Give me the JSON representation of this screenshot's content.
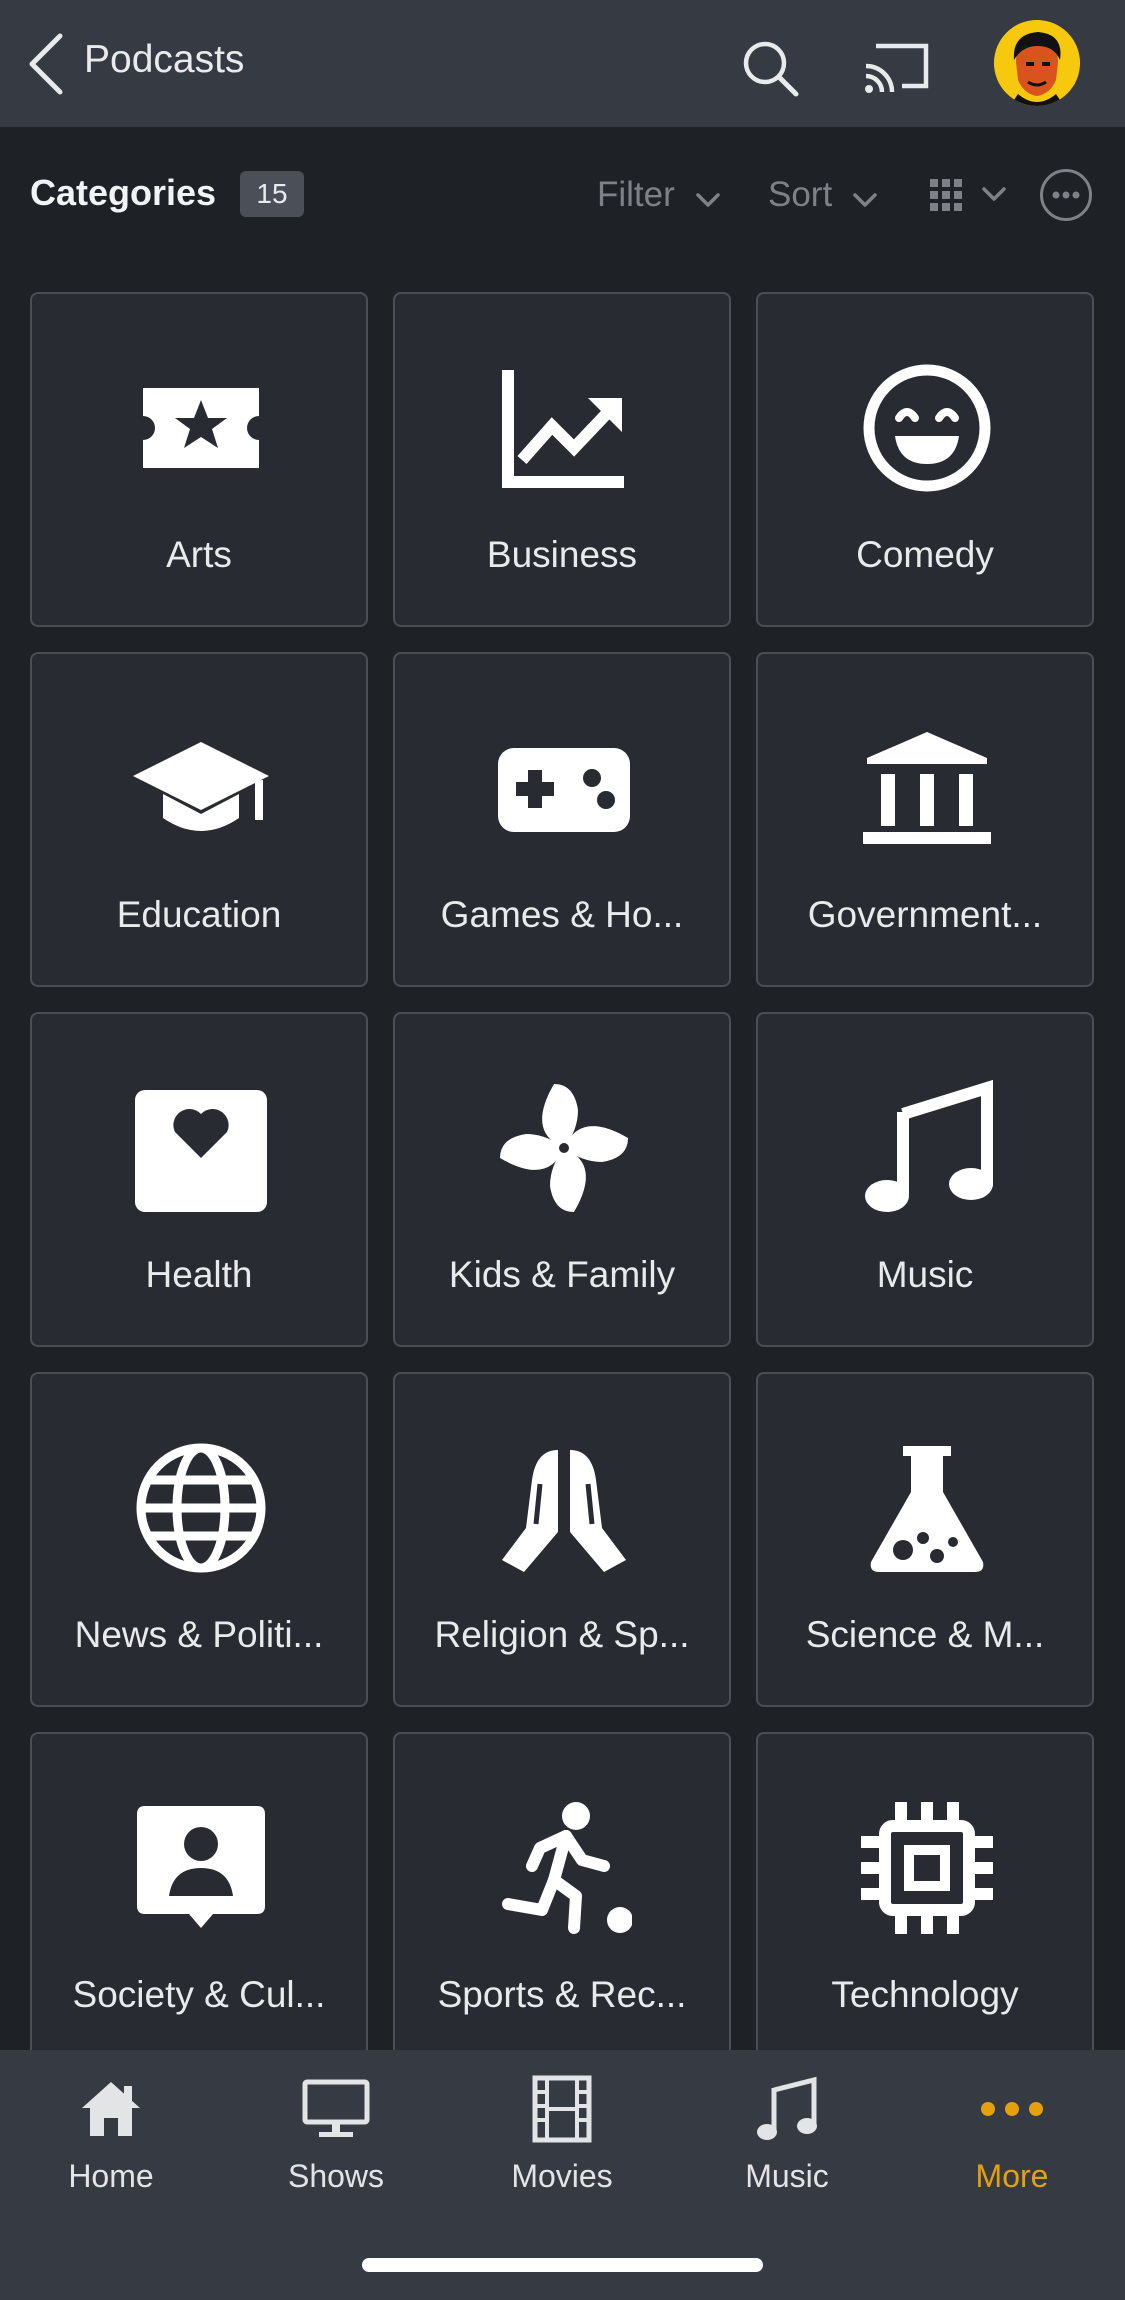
{
  "header": {
    "title": "Podcasts",
    "icons": [
      "chevron-left-icon",
      "search-icon",
      "cast-icon",
      "avatar"
    ]
  },
  "toolbar": {
    "section_title": "Categories",
    "count": "15",
    "filter_label": "Filter",
    "sort_label": "Sort"
  },
  "categories": [
    {
      "label": "Arts",
      "icon": "ticket-star-icon"
    },
    {
      "label": "Business",
      "icon": "trending-chart-icon"
    },
    {
      "label": "Comedy",
      "icon": "smiley-icon"
    },
    {
      "label": "Education",
      "icon": "graduation-cap-icon"
    },
    {
      "label": "Games & Ho...",
      "icon": "gamepad-icon"
    },
    {
      "label": "Government...",
      "icon": "institution-icon"
    },
    {
      "label": "Health",
      "icon": "heart-card-icon"
    },
    {
      "label": "Kids & Family",
      "icon": "pinwheel-icon"
    },
    {
      "label": "Music",
      "icon": "music-note-icon"
    },
    {
      "label": "News & Politi...",
      "icon": "globe-icon"
    },
    {
      "label": "Religion & Sp...",
      "icon": "praying-hands-icon"
    },
    {
      "label": "Science & M...",
      "icon": "flask-icon"
    },
    {
      "label": "Society & Cul...",
      "icon": "person-card-icon"
    },
    {
      "label": "Sports & Rec...",
      "icon": "athlete-ball-icon"
    },
    {
      "label": "Technology",
      "icon": "cpu-chip-icon"
    }
  ],
  "tabs": [
    {
      "label": "Home",
      "icon": "home-icon",
      "active": false
    },
    {
      "label": "Shows",
      "icon": "monitor-icon",
      "active": false
    },
    {
      "label": "Movies",
      "icon": "film-icon",
      "active": false
    },
    {
      "label": "Music",
      "icon": "music-note-icon",
      "active": false
    },
    {
      "label": "More",
      "icon": "more-dots-icon",
      "active": true
    }
  ],
  "colors": {
    "background": "#1e2227",
    "bar": "#363b43",
    "card": "#282c32",
    "accent": "#e5a00d"
  }
}
